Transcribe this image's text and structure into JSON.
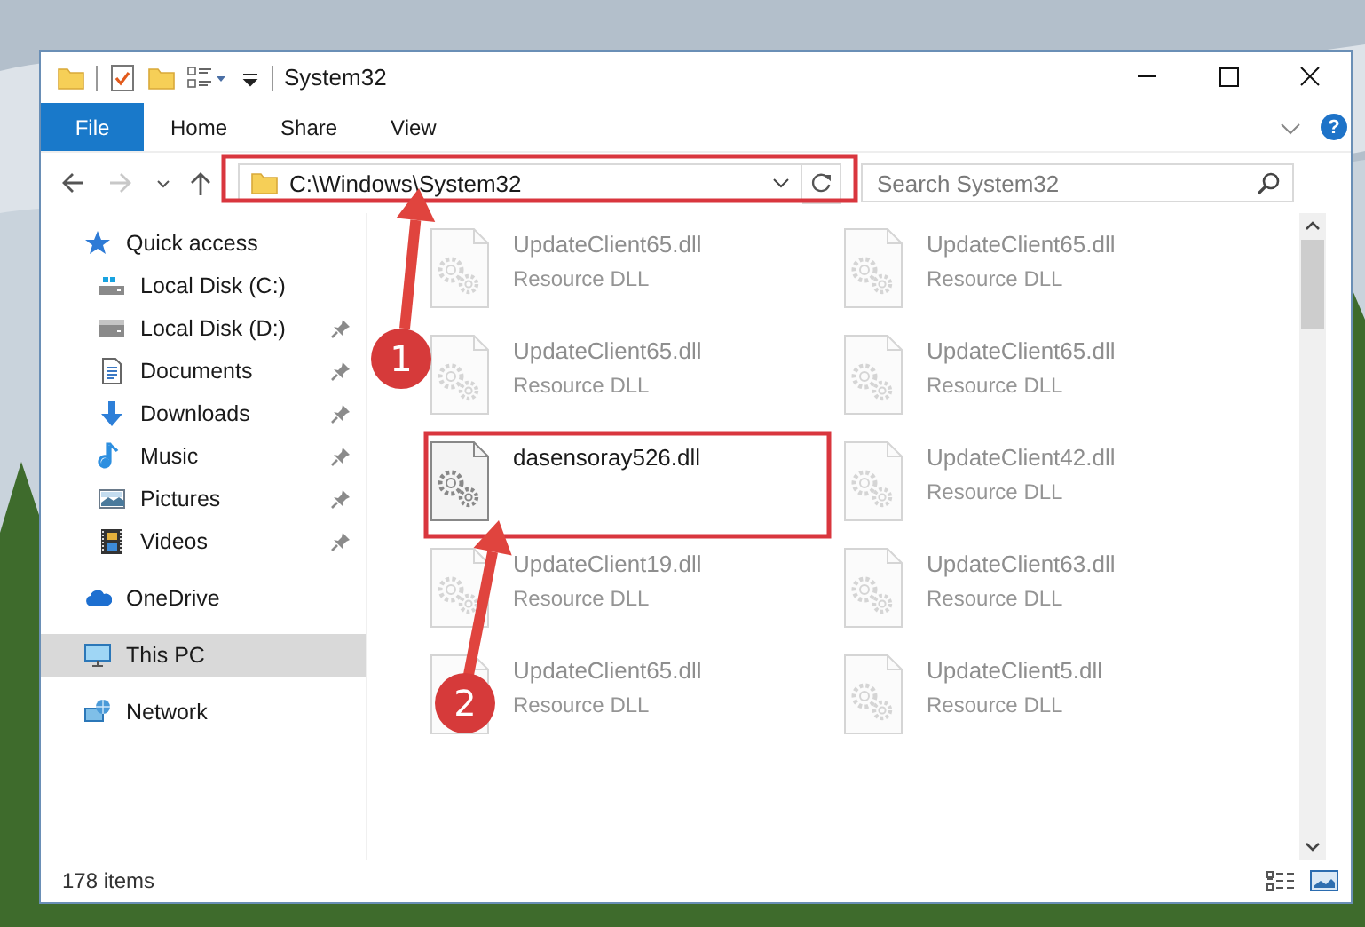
{
  "window": {
    "title": "System32"
  },
  "ribbon": {
    "tabs": [
      {
        "label": "File",
        "kind": "file"
      },
      {
        "label": "Home",
        "kind": "tab"
      },
      {
        "label": "Share",
        "kind": "tab"
      },
      {
        "label": "View",
        "kind": "tab"
      }
    ],
    "help_label": "?"
  },
  "navigation": {
    "forward_disabled": true
  },
  "address_bar": {
    "path": "C:\\Windows\\System32"
  },
  "search": {
    "placeholder": "Search System32"
  },
  "sidebar": {
    "items": [
      {
        "label": "Quick access",
        "selected": false,
        "pinned": false,
        "children": [
          {
            "label": "Local Disk (C:)",
            "selected": false,
            "pinned": false
          },
          {
            "label": "Local Disk (D:)",
            "selected": false,
            "pinned": true
          },
          {
            "label": "Documents",
            "selected": false,
            "pinned": true
          },
          {
            "label": "Downloads",
            "selected": false,
            "pinned": true
          },
          {
            "label": "Music",
            "selected": false,
            "pinned": true
          },
          {
            "label": "Pictures",
            "selected": false,
            "pinned": true
          },
          {
            "label": "Videos",
            "selected": false,
            "pinned": true
          }
        ]
      },
      {
        "label": "OneDrive",
        "selected": false,
        "pinned": false
      },
      {
        "label": "This PC",
        "selected": true,
        "pinned": false
      },
      {
        "label": "Network",
        "selected": false,
        "pinned": false
      }
    ]
  },
  "files": [
    {
      "name": "UpdateClient65.dll",
      "type": "Resource DLL",
      "faded": true
    },
    {
      "name": "UpdateClient65.dll",
      "type": "Resource DLL",
      "faded": true
    },
    {
      "name": "UpdateClient65.dll",
      "type": "Resource DLL",
      "faded": true
    },
    {
      "name": "UpdateClient65.dll",
      "type": "Resource DLL",
      "faded": true
    },
    {
      "name": "dasensoray526.dll",
      "faded": false
    },
    {
      "name": "UpdateClient42.dll",
      "type": "Resource DLL",
      "faded": true
    },
    {
      "name": "UpdateClient19.dll",
      "type": "Resource DLL",
      "faded": true
    },
    {
      "name": "UpdateClient63.dll",
      "type": "Resource DLL",
      "faded": true
    },
    {
      "name": "UpdateClient65.dll",
      "type": "Resource DLL",
      "faded": true
    },
    {
      "name": "UpdateClient5.dll",
      "type": "Resource DLL",
      "faded": true
    }
  ],
  "status_bar": {
    "item_count": "178 items"
  },
  "annotations": [
    {
      "number": "1"
    },
    {
      "number": "2"
    }
  ]
}
